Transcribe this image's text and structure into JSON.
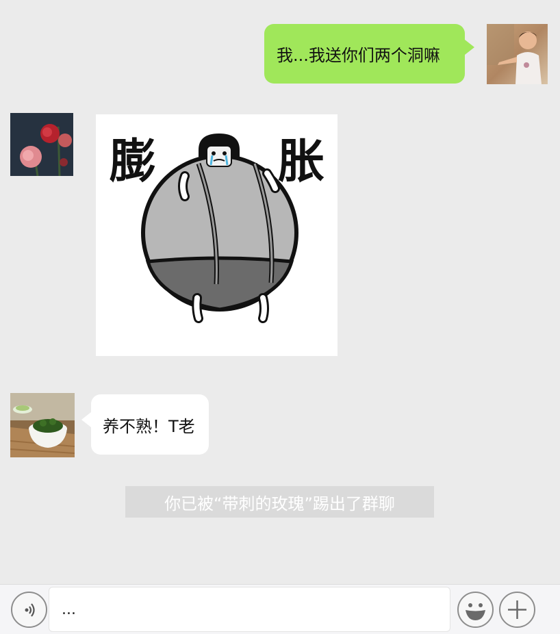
{
  "messages": [
    {
      "sender": "self",
      "avatar": "boy-photo",
      "type": "text",
      "text": "我...我送你们两个洞嘛"
    },
    {
      "sender": "other",
      "avatar": "rose-photo",
      "type": "sticker",
      "sticker": {
        "left_char": "膨",
        "right_char": "胀",
        "icon": "inflated-ball-man-sticker"
      }
    },
    {
      "sender": "other",
      "avatar": "tea-photo",
      "type": "text",
      "text": "养不熟！T老"
    }
  ],
  "system_notice": "你已被“带刺的玫瑰”踢出了群聊",
  "input_bar": {
    "voice_icon": "voice-icon",
    "text_value": "...",
    "emoji_icon": "emoji-icon",
    "plus_icon": "plus-icon"
  },
  "colors": {
    "background": "#ebebeb",
    "self_bubble": "#a0e75a",
    "other_bubble": "#ffffff",
    "notice_bg": "#dadada"
  }
}
